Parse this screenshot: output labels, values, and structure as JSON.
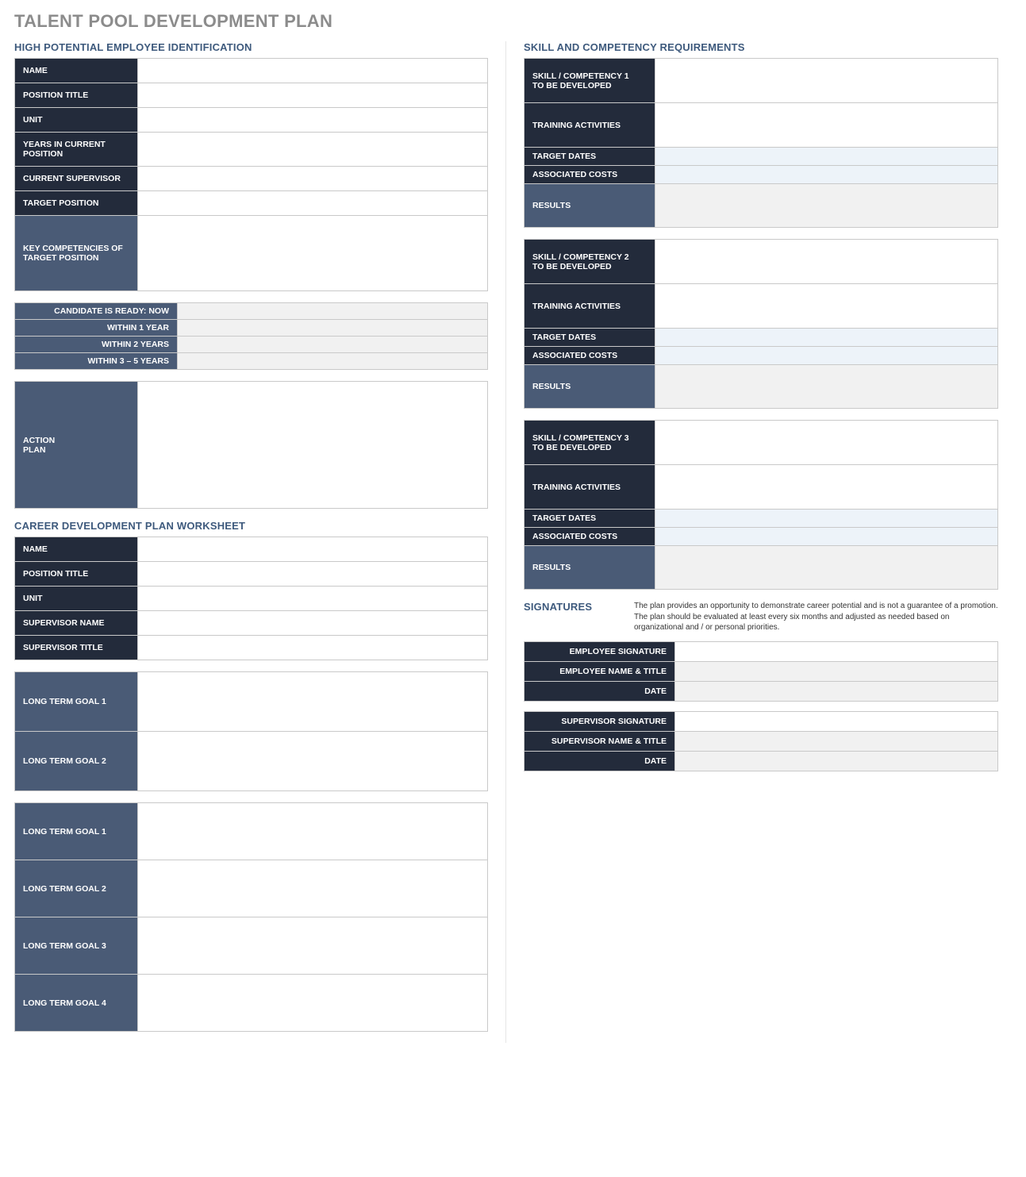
{
  "title": "TALENT POOL DEVELOPMENT PLAN",
  "left": {
    "hp_section": "HIGH POTENTIAL EMPLOYEE IDENTIFICATION",
    "hp_fields": {
      "name": "NAME",
      "position_title": "POSITION TITLE",
      "unit": "UNIT",
      "years": "YEARS IN CURRENT POSITION",
      "supervisor": "CURRENT SUPERVISOR",
      "target_position": "TARGET POSITION",
      "key_competencies": "KEY COMPETENCIES OF TARGET POSITION"
    },
    "readiness": {
      "now": "CANDIDATE IS READY:  NOW",
      "y1": "WITHIN 1 YEAR",
      "y2": "WITHIN 2 YEARS",
      "y35": "WITHIN 3 – 5 YEARS"
    },
    "action_plan": "ACTION\nPLAN",
    "cdp_section": "CAREER DEVELOPMENT PLAN WORKSHEET",
    "cdp_fields": {
      "name": "NAME",
      "position_title": "POSITION TITLE",
      "unit": "UNIT",
      "supervisor_name": "SUPERVISOR NAME",
      "supervisor_title": "SUPERVISOR TITLE"
    },
    "ltg_a": {
      "g1": "LONG TERM GOAL 1",
      "g2": "LONG TERM GOAL 2"
    },
    "ltg_b": {
      "g1": "LONG TERM GOAL 1",
      "g2": "LONG TERM GOAL 2",
      "g3": "LONG TERM GOAL 3",
      "g4": "LONG TERM GOAL 4"
    }
  },
  "right": {
    "skill_section": "SKILL AND COMPETENCY REQUIREMENTS",
    "comp1": {
      "title_l1": "SKILL / COMPETENCY 1",
      "title_l2": "TO BE DEVELOPED",
      "training": "TRAINING ACTIVITIES",
      "dates": "TARGET DATES",
      "costs": "ASSOCIATED COSTS",
      "results": "RESULTS"
    },
    "comp2": {
      "title_l1": "SKILL / COMPETENCY 2",
      "title_l2": "TO BE DEVELOPED",
      "training": "TRAINING ACTIVITIES",
      "dates": "TARGET DATES",
      "costs": "ASSOCIATED COSTS",
      "results": "RESULTS"
    },
    "comp3": {
      "title_l1": "SKILL / COMPETENCY 3",
      "title_l2": "TO BE DEVELOPED",
      "training": "TRAINING ACTIVITIES",
      "dates": "TARGET DATES",
      "costs": "ASSOCIATED COSTS",
      "results": "RESULTS"
    },
    "sig_section": "SIGNATURES",
    "sig_note": "The plan provides an opportunity to demonstrate career potential and is not a guarantee of a promotion. The plan should be evaluated at least every six months and adjusted as needed based on organizational and / or personal priorities.",
    "sig_emp": {
      "sig": "EMPLOYEE SIGNATURE",
      "name": "EMPLOYEE NAME & TITLE",
      "date": "DATE"
    },
    "sig_sup": {
      "sig": "SUPERVISOR SIGNATURE",
      "name": "SUPERVISOR NAME & TITLE",
      "date": "DATE"
    }
  }
}
